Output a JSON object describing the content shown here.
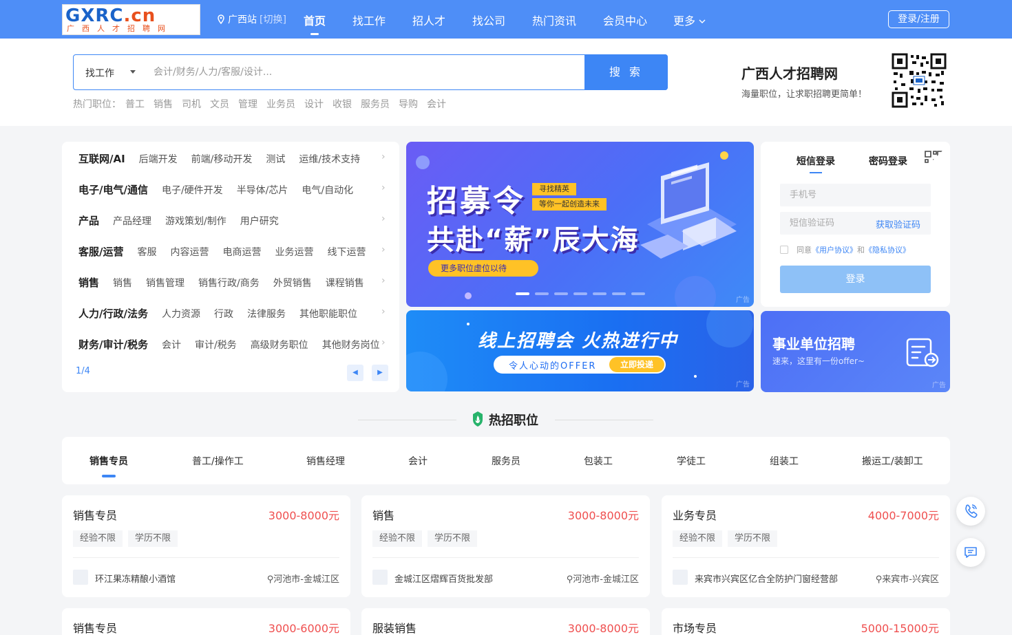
{
  "nav": {
    "logo_main": "GXRC",
    "logo_dot": ".cn",
    "logo_sub": "广西人才招聘网",
    "location": "广西站",
    "switch": "[切换]",
    "items": [
      "首页",
      "找工作",
      "招人才",
      "找公司",
      "热门资讯",
      "会员中心",
      "更多"
    ],
    "login": "登录/注册"
  },
  "search": {
    "type": "找工作",
    "placeholder": "会计/财务/人力/客服/设计...",
    "button": "搜 索",
    "hot_label": "热门职位：",
    "hot": [
      "普工",
      "销售",
      "司机",
      "文员",
      "管理",
      "业务员",
      "设计",
      "收银",
      "服务员",
      "导购",
      "会计"
    ]
  },
  "brand": {
    "name": "广西人才招聘网",
    "slogan": "海量职位，让求职招聘更简单！"
  },
  "categories": [
    {
      "title": "互联网/AI",
      "items": [
        "后端开发",
        "前端/移动开发",
        "测试",
        "运维/技术支持"
      ]
    },
    {
      "title": "电子/电气/通信",
      "items": [
        "电子/硬件开发",
        "半导体/芯片",
        "电气/自动化"
      ]
    },
    {
      "title": "产品",
      "items": [
        "产品经理",
        "游戏策划/制作",
        "用户研究"
      ]
    },
    {
      "title": "客服/运营",
      "items": [
        "客服",
        "内容运营",
        "电商运营",
        "业务运营",
        "线下运营"
      ]
    },
    {
      "title": "销售",
      "items": [
        "销售",
        "销售管理",
        "销售行政/商务",
        "外贸销售",
        "课程销售"
      ]
    },
    {
      "title": "人力/行政/法务",
      "items": [
        "人力资源",
        "行政",
        "法律服务",
        "其他职能职位"
      ]
    },
    {
      "title": "财务/审计/税务",
      "items": [
        "会计",
        "审计/税务",
        "高级财务职位",
        "其他财务岗位"
      ]
    }
  ],
  "pager": "1/4",
  "banner1": {
    "title1": "招募令",
    "tag1": "寻找精英",
    "tag2": "等你一起创造未来",
    "title2": "共赴“薪”辰大海",
    "button": "更多职位虚位以待",
    "ad": "广告"
  },
  "banner2": {
    "title": "线上招聘会 火热进行中",
    "sub": "令人心动的OFFER",
    "button": "立即投递",
    "ad": "广告"
  },
  "login": {
    "tab_sms": "短信登录",
    "tab_pwd": "密码登录",
    "phone_placeholder": "手机号",
    "code_placeholder": "短信验证码",
    "get_code": "获取验证码",
    "agree_prefix": "同意",
    "user_agreement": "《用户协议》",
    "and": "和",
    "privacy": "《隐私协议》",
    "button": "登录"
  },
  "banner3": {
    "title": "事业单位招聘",
    "sub": "速来，这里有一份offer~",
    "ad": "广告"
  },
  "hot_jobs": {
    "title": "热招职位",
    "tabs": [
      "销售专员",
      "普工/操作工",
      "销售经理",
      "会计",
      "服务员",
      "包装工",
      "学徒工",
      "组装工",
      "搬运工/装卸工"
    ]
  },
  "jobs": [
    {
      "title": "销售专员",
      "salary": "3000-8000元",
      "tags": [
        "经验不限",
        "学历不限"
      ],
      "company": "环江果冻精酿小酒馆",
      "location": "河池市-金城江区"
    },
    {
      "title": "销售",
      "salary": "3000-8000元",
      "tags": [
        "经验不限",
        "学历不限"
      ],
      "company": "金城江区熠辉百货批发部",
      "location": "河池市-金城江区"
    },
    {
      "title": "业务专员",
      "salary": "4000-7000元",
      "tags": [
        "经验不限",
        "学历不限"
      ],
      "company": "来宾市兴宾区亿合全防护门窗经营部",
      "location": "来宾市-兴宾区"
    },
    {
      "title": "销售专员",
      "salary": "3000-6000元",
      "tags": [],
      "company": "",
      "location": ""
    },
    {
      "title": "服装销售",
      "salary": "3000-8000元",
      "tags": [],
      "company": "",
      "location": ""
    },
    {
      "title": "市场专员",
      "salary": "5000-15000元",
      "tags": [],
      "company": "",
      "location": ""
    }
  ],
  "colors": {
    "primary": "#3d86f5",
    "nav": "#4e8ef7",
    "salary": "#ef4f4f"
  }
}
